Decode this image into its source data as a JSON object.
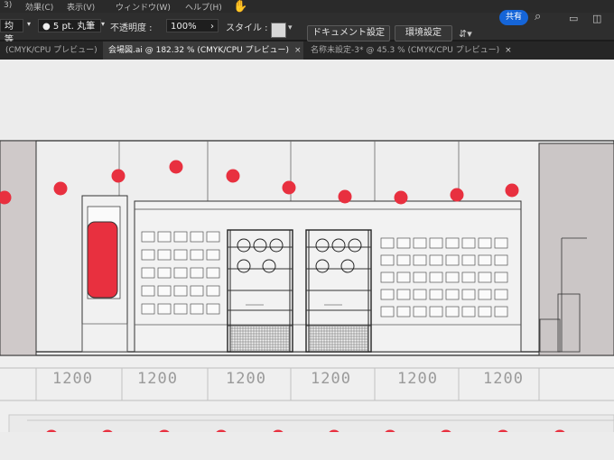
{
  "menu": {
    "items": [
      "3)",
      "効果(C)",
      "表示(V)",
      "ウィンドウ(W)",
      "ヘルプ(H)"
    ],
    "share_label": "共有"
  },
  "control": {
    "profile_label": "均等",
    "brush_value": "5 pt. 丸筆",
    "opacity_label": "不透明度 :",
    "opacity_value": "100%",
    "style_label": "スタイル :",
    "doc_settings_label": "ドキュメント設定",
    "prefs_label": "環境設定"
  },
  "tabs": [
    {
      "label": "(CMYK/CPU プレビュー)",
      "close": "×"
    },
    {
      "label": "会場図.ai @ 182.32 % (CMYK/CPU プレビュー)",
      "close": "×"
    },
    {
      "label": "名称未設定-3* @ 45.3 % (CMYK/CPU プレビュー)",
      "close": "×"
    }
  ],
  "canvas": {
    "dimension_labels": [
      "1200",
      "1200",
      "1200",
      "1200",
      "1200",
      "1200"
    ],
    "marker_color": "#e8303f",
    "panel_color": "#e8303f"
  }
}
